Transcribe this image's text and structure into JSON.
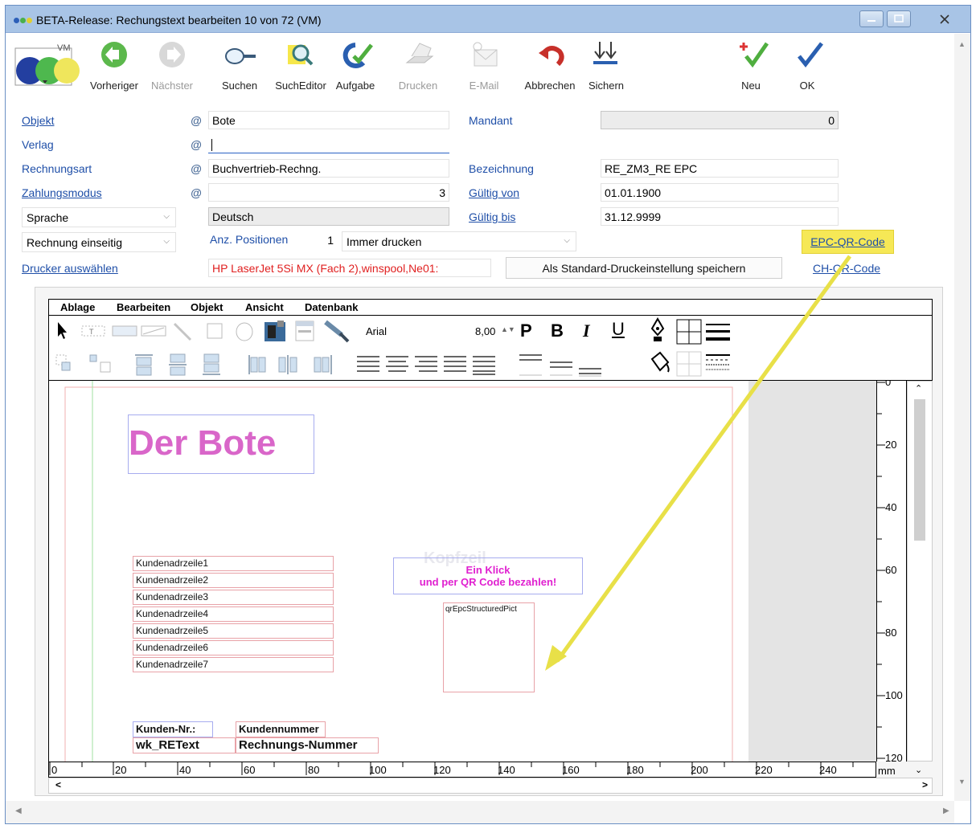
{
  "window": {
    "title": "BETA-Release: Rechungstext  bearbeiten 10 von 72 (VM)",
    "vm_label": "VM"
  },
  "toolbar": {
    "prev": "Vorheriger",
    "next": "Nächster",
    "search": "Suchen",
    "searcheditor": "SuchEditor",
    "task": "Aufgabe",
    "print": "Drucken",
    "email": "E-Mail",
    "cancel": "Abbrechen",
    "save": "Sichern",
    "new": "Neu",
    "ok": "OK"
  },
  "form": {
    "objekt_label": "Objekt",
    "objekt_value": "Bote",
    "verlag_label": "Verlag",
    "verlag_value": "",
    "rechnungsart_label": "Rechnungsart",
    "rechnungsart_value": "Buchvertrieb-Rechng.",
    "zahlungsmodus_label": "Zahlungsmodus",
    "zahlungsmodus_value": "3",
    "sprache_select": "Sprache",
    "sprache_value": "Deutsch",
    "rechnung_select": "Rechnung einseitig",
    "anz_label": "Anz. Positionen",
    "anz_value": "1",
    "druck_select": "Immer drucken",
    "drucker_link": "Drucker auswählen",
    "drucker_value": "HP LaserJet 5Si MX (Fach 2),winspool,Ne01:",
    "standard_button": "Als Standard-Druckeinstellung speichern",
    "mandant_label": "Mandant",
    "mandant_value": "0",
    "bezeichnung_label": "Bezeichnung",
    "bezeichnung_value": "RE_ZM3_RE EPC",
    "gueltig_von_label": "Gültig von",
    "gueltig_von_value": "01.01.1900",
    "gueltig_bis_label": "Gültig bis",
    "gueltig_bis_value": "31.12.9999",
    "epc_link": "EPC-QR-Code",
    "ch_link": "CH-QR-Code",
    "at_symbol": "@"
  },
  "designer": {
    "menu": [
      "Ablage",
      "Bearbeiten",
      "Objekt",
      "Ansicht",
      "Datenbank"
    ],
    "font_name": "Arial",
    "font_size": "8,00",
    "style_p": "P",
    "style_b": "B",
    "style_i": "I",
    "style_u": "U",
    "title_text": "Der Bote",
    "kundenadr": [
      "Kundenadrzeile1",
      "Kundenadrzeile2",
      "Kundenadrzeile3",
      "Kundenadrzeile4",
      "Kundenadrzeile5",
      "Kundenadrzeile6",
      "Kundenadrzeile7"
    ],
    "watermark": "Kopfzeil",
    "promo_line1": "Ein Klick",
    "promo_line2": "und per QR Code bezahlen!",
    "qr_field": "qrEpcStructuredPict",
    "kunden_nr_label": "Kunden-Nr.:",
    "kunden_nr_field": "Kundennummer",
    "retext_field": "wk_REText",
    "rechnungs_nr_field": "Rechnungs-Nummer",
    "vruler": [
      "0",
      "20",
      "40",
      "60",
      "80",
      "100",
      "120"
    ],
    "hruler": [
      "0",
      "20",
      "40",
      "60",
      "80",
      "100",
      "120",
      "140",
      "160",
      "180",
      "200",
      "220",
      "240"
    ],
    "unit": "mm"
  },
  "colors": {
    "accent": "#1f4fa8",
    "title_pink": "#d966c9",
    "promo_magenta": "#e020d0",
    "highlight_yellow": "#f6e856",
    "printer_red": "#e02020"
  }
}
